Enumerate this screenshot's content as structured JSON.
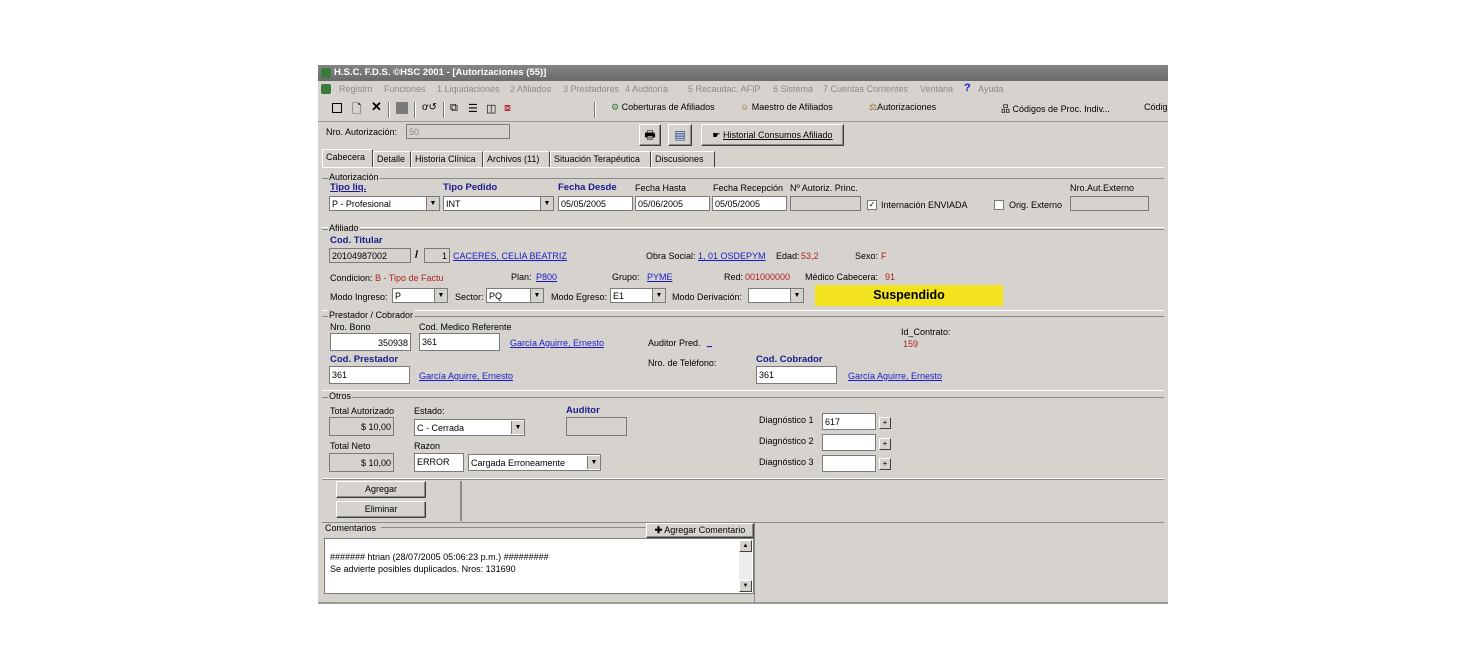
{
  "window": {
    "title": "H.S.C. F.D.S. ©HSC 2001 - [Autorizaciones (55)]"
  },
  "menu": [
    "Registro",
    "Funciones",
    "1 Liquidaciones",
    "2 Afiliados",
    "3 Prestadores",
    "4 Auditoría",
    "5 Recaudac. AFIP",
    "6 Sistema",
    "7 Cuentas Corrientes",
    "Ventana",
    "Ayuda"
  ],
  "toolbar": {
    "coberturas": "Coberturas de Afiliados",
    "maestro": "Maestro de Afiliados",
    "autorizaciones": "Autorizaciones",
    "codigos": "Códigos de Proc. Indiv...",
    "codig": "Códig"
  },
  "header": {
    "nro_aut_label": "Nro. Autorización:",
    "nro_aut_value": "50",
    "historial": "Historial Consumos Afiliado"
  },
  "tabs": [
    "Cabecera",
    "Detalle",
    "Historia Clínica",
    "Archivos (11)",
    "Situación Terapéutica",
    "Discusiones"
  ],
  "autorizacion": {
    "title": "Autorización",
    "tipo_liq_label": "Tipo liq.",
    "tipo_liq_value": "P - Profesional",
    "tipo_pedido_label": "Tipo Pedido",
    "tipo_pedido_value": "INT",
    "fecha_desde_label": "Fecha Desde",
    "fecha_desde_value": "05/05/2005",
    "fecha_hasta_label": "Fecha Hasta",
    "fecha_hasta_value": "05/06/2005",
    "fecha_recepcion_label": "Fecha Recepción",
    "fecha_recepcion_value": "05/05/2005",
    "nro_autoriz_label": "Nº Autoriz. Princ.",
    "internacion_label": "Internación ENVIADA",
    "orig_externo_label": "Orig. Externo",
    "nro_aut_externo_label": "Nro.Aut.Externo"
  },
  "afiliado": {
    "title": "Afiliado",
    "cod_titular_label": "Cod. Titular",
    "cod_titular_value": "20104987002",
    "slash": "/",
    "sub": "1",
    "nombre": "CACERES, CELIA BEATRIZ",
    "obra_social_label": "Obra Social:",
    "obra_social_value": "1, 01 OSDEPYM",
    "edad_label": "Edad:",
    "edad_value": "53,2",
    "sexo_label": "Sexo:",
    "sexo_value": "F",
    "condicion_label": "Condicion:",
    "condicion_value": "B - Tipo de Factu",
    "plan_label": "Plan:",
    "plan_value": "P800",
    "grupo_label": "Grupo:",
    "grupo_value": "PYME",
    "red_label": "Red:",
    "red_value": "001000000",
    "medico_label": "Médico Cabecera:",
    "medico_value": "91",
    "modo_ingreso_label": "Modo Ingreso:",
    "modo_ingreso_value": "P",
    "sector_label": "Sector:",
    "sector_value": "PQ",
    "modo_egreso_label": "Modo Egreso:",
    "modo_egreso_value": "E1",
    "modo_derivacion_label": "Modo Derivación:",
    "modo_derivacion_value": "",
    "estado_badge": "Suspendido"
  },
  "prestador": {
    "title": "Prestador / Cobrador",
    "nro_bono_label": "Nro. Bono",
    "nro_bono_value": "350938",
    "cod_medico_label": "Cod. Medico Referente",
    "cod_medico_value": "361",
    "cod_medico_name": "García Aguirre, Ernesto",
    "auditor_pred_label": "Auditor Pred.",
    "auditor_pred_value": "_",
    "id_contrato_label": "Id_Contrato:",
    "id_contrato_value": "159",
    "cod_prestador_label": "Cod. Prestador",
    "cod_prestador_value": "361",
    "cod_prestador_name": "García Aguirre, Ernesto",
    "nro_telefono_label": "Nro. de Teléfono:",
    "cod_cobrador_label": "Cod. Cobrador",
    "cod_cobrador_value": "361",
    "cod_cobrador_name": "García Aguirre, Ernesto"
  },
  "otros": {
    "title": "Otros",
    "total_aut_label": "Total Autorizado",
    "total_aut_value": "$ 10,00",
    "estado_label": "Estado:",
    "estado_value": "C - Cerrada",
    "auditor_label": "Auditor",
    "total_neto_label": "Total Neto",
    "total_neto_value": "$ 10,00",
    "razon_label": "Razon",
    "razon_code": "ERROR",
    "razon_value": "Cargada Erroneamente",
    "diag1_label": "Diagnóstico 1",
    "diag1_value": "617",
    "diag2_label": "Diagnóstico 2",
    "diag2_value": "",
    "diag3_label": "Diagnóstico 3",
    "diag3_value": ""
  },
  "actions": {
    "agregar": "Agregar",
    "eliminar": "Eliminar"
  },
  "comentarios": {
    "title": "Comentarios",
    "agregar_btn": "Agregar Comentario",
    "line1": "####### htrian (28/07/2005 05:06:23 p.m.) #########",
    "line2": "Se advierte posibles duplicados. Nros: 131690"
  },
  "colors": {
    "status_badge": "#f2e31e",
    "label_blue": "#1a1a8c",
    "link": "#1a1acc",
    "window_bg": "#d6d3ce"
  }
}
